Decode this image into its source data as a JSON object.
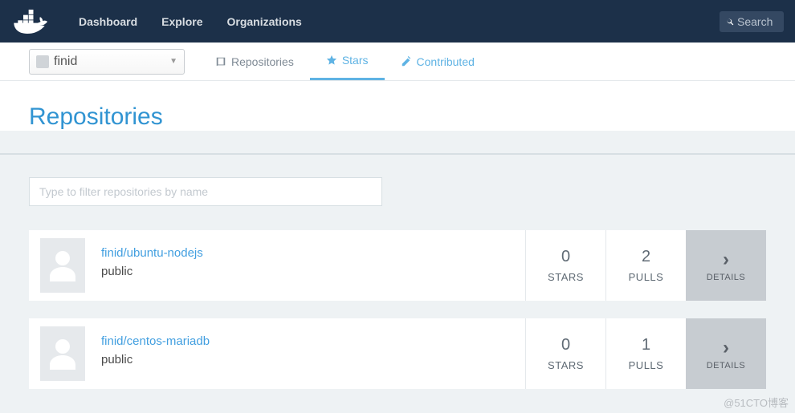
{
  "nav": {
    "links": [
      "Dashboard",
      "Explore",
      "Organizations"
    ],
    "search_placeholder": "Search"
  },
  "user": {
    "name": "finid"
  },
  "tabs": [
    {
      "label": "Repositories"
    },
    {
      "label": "Stars"
    },
    {
      "label": "Contributed"
    }
  ],
  "page": {
    "title": "Repositories",
    "filter_placeholder": "Type to filter repositories by name"
  },
  "labels": {
    "stars": "STARS",
    "pulls": "PULLS",
    "details": "DETAILS"
  },
  "repos": [
    {
      "name": "finid/ubuntu-nodejs",
      "visibility": "public",
      "stars": 0,
      "pulls": 2
    },
    {
      "name": "finid/centos-mariadb",
      "visibility": "public",
      "stars": 0,
      "pulls": 1
    }
  ],
  "watermark": "@51CTO博客"
}
